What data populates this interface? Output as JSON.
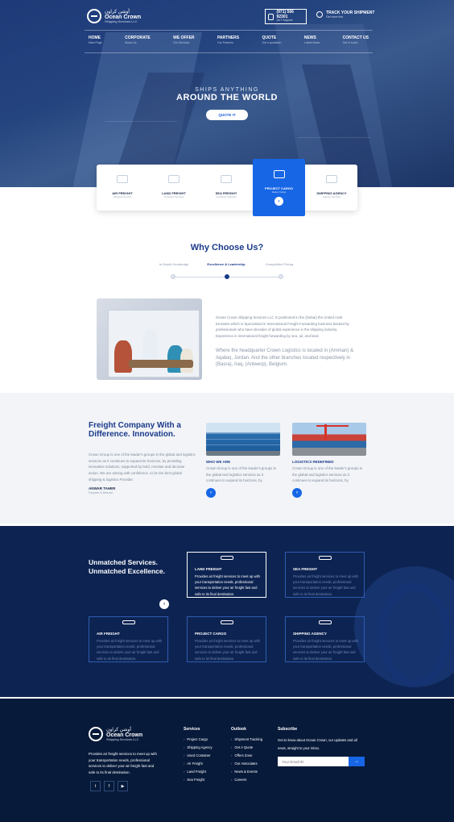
{
  "header": {
    "logo_ar": "أوشن كراون",
    "logo_en": "Ocean Crown",
    "logo_sub": "Shipping Services LLC",
    "phone": "(971) 566 92301",
    "phone_sub": "24/7 Support",
    "track_title": "TRACK YOUR SHIPMENT",
    "track_sub": "Get more info"
  },
  "nav": [
    {
      "label": "HOME",
      "sub": "Main Page"
    },
    {
      "label": "CORPORATE",
      "sub": "About Us"
    },
    {
      "label": "WE OFFER",
      "sub": "Our Services"
    },
    {
      "label": "PARTNERS",
      "sub": "Our Partners"
    },
    {
      "label": "QUOTE",
      "sub": "Get a quotation"
    },
    {
      "label": "NEWS",
      "sub": "Latest News"
    },
    {
      "label": "CONTACT US",
      "sub": "Get in touch"
    }
  ],
  "hero": {
    "kicker": "SHIPS ANYTHING",
    "title": "AROUND THE WORLD",
    "button": "QUOTE IT"
  },
  "tabs": [
    {
      "label": "AIR FREIGHT",
      "sub": "Shipping Service"
    },
    {
      "label": "LAND FREIGHT",
      "sub": "Transport Services"
    },
    {
      "label": "SEA FREIGHT",
      "sub": "Container Shipping"
    },
    {
      "label": "PROJECT CARGO",
      "sub": "Heavy Cargo"
    },
    {
      "label": "SHIPPING AGENCY",
      "sub": "Agency Services"
    }
  ],
  "why": {
    "title": "Why Choose Us?",
    "steps": [
      {
        "label": "In-Depth Knowledge"
      },
      {
        "label": "Excellence & Leadership"
      },
      {
        "label": "Competitive Pricing"
      }
    ]
  },
  "about": {
    "text1": "Ocean Crown Shipping Services LLC is positioned in the (Dubai) the United Arab Emirates which is Specialised in International Freight Forwarding business backed by professionals who have decades of global experience in the shipping industry. Experience in international freight forwarding by sea, air, and land.",
    "text2": "Where the headquarter Crown Logistics is located in (Amman) & Aqaba), Jordan. And the other branches located respectively in (Basra), Iraq, (Antwerp), Belgium."
  },
  "freight": {
    "heading": "Freight Company With a Difference. Innovation.",
    "text": "Crown Group is one of the leader's groups in the global and logistics services as it continues to expand its horizons, by providing innovative solutions, supported by bold, resolute and decisive action. We are aiming with confidence, to be the best global shipping & logistics Provider.",
    "name": "ANWAR TAHER",
    "role": "Founder & Director",
    "cards": [
      {
        "title": "WHO WE ARE",
        "text": "Crown Group is one of the leader's groups in the global and logistics services as it continues to expand its horizons, by"
      },
      {
        "title": "LOGISTICS REDEFINED",
        "text": "Crown Group is one of the leader's groups in the global and logistics services as it continues to expand its horizons, by"
      }
    ]
  },
  "services": {
    "heading": "Unmatched Services. Unmatched Excellence.",
    "items": [
      {
        "title": "LAND FREIGHT",
        "text": "Provides air freight services to meet up with your transportation needs, professional services to deliver your air freight fast and safe to its final destination."
      },
      {
        "title": "SEA FREIGHT",
        "text": "Provides air freight services to meet up with your transportation needs, professional services to deliver your air freight fast and safe to its final destination."
      },
      {
        "title": "AIR FREIGHT",
        "text": "Provides air freight services to meet up with your transportation needs, professional services to deliver your air freight fast and safe to its final destination."
      },
      {
        "title": "PROJECT CARGO",
        "text": "Provides air freight services to meet up with your transportation needs, professional services to deliver your air freight fast and safe to its final destination."
      },
      {
        "title": "SHIPPING AGENCY",
        "text": "Provides air freight services to meet up with your transportation needs, professional services to deliver your air freight fast and safe to its final destination."
      }
    ]
  },
  "footer": {
    "text": "Provides air freight services to meet up with your transportation needs, professional services to deliver your air freight fast and safe to its final destination.",
    "socials": [
      {
        "label": "t",
        "icon": "twitter-icon"
      },
      {
        "label": "f",
        "icon": "facebook-icon"
      },
      {
        "label": "▶",
        "icon": "youtube-icon"
      }
    ],
    "col_services": {
      "title": "Services",
      "links": [
        "Project Cargo",
        "Shipping Agency",
        "Used Container",
        "Air Freight",
        "Land Freight",
        "Sea Freight"
      ]
    },
    "col_outlook": {
      "title": "Outlook",
      "links": [
        "Shipment Tracking",
        "Get A Quote",
        "Offers Zone",
        "Our Associates",
        "News & Events",
        "Careers"
      ]
    },
    "subscribe": {
      "title": "Subscribe",
      "text": "Get to know about Ocean Crown, our updates and all news, straight to your inbox.",
      "placeholder": "Your Email ID",
      "button": "→"
    }
  },
  "colors": {
    "primary": "#1766e6",
    "navy": "#0d2452",
    "heading": "#1a3a8a",
    "footer": "#071a3a"
  }
}
